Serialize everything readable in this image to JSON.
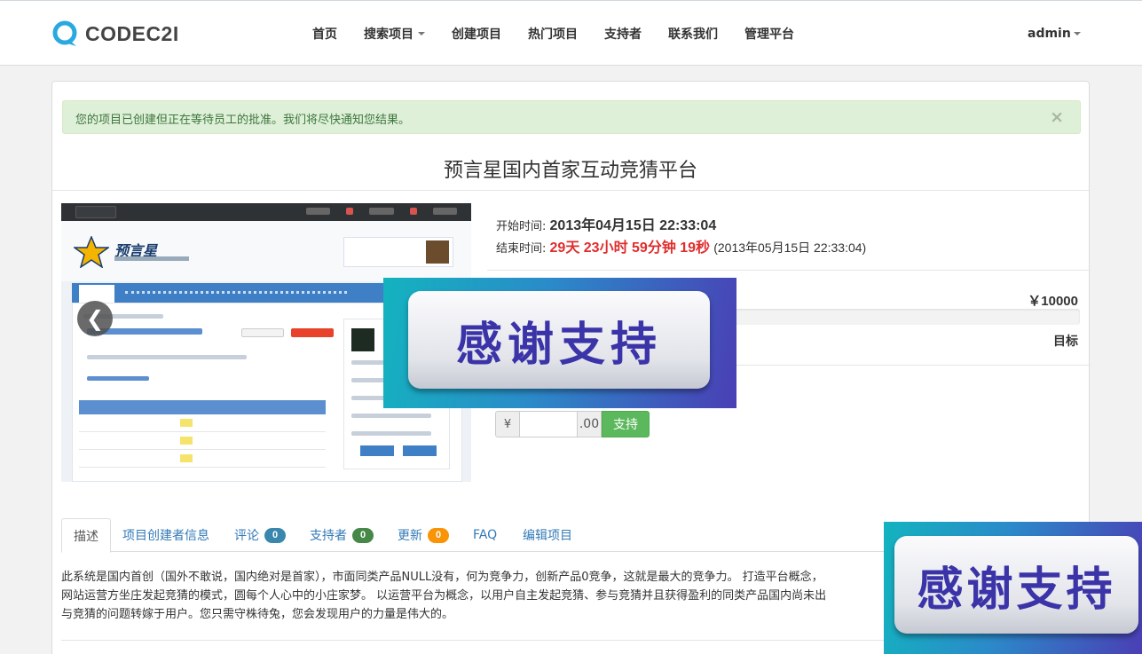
{
  "brand": {
    "name": "CODEC2I"
  },
  "nav": {
    "items": [
      "首页",
      "搜索项目",
      "创建项目",
      "热门项目",
      "支持者",
      "联系我们",
      "管理平台"
    ],
    "user": "admin"
  },
  "alert": {
    "message": "您的项目已创建但正在等待员工的批准。我们将尽快通知您结果。",
    "close": "×"
  },
  "project": {
    "title": "预言星国内首家互动竞猜平台",
    "start_label": "开始时间:",
    "start_value": "2013年04月15日 22:33:04",
    "end_label": "结束时间:",
    "countdown": "29天 23小时 59分钟 19秒",
    "end_value": "(2013年05月15日 22:33:04)",
    "goal_amount": "￥10000",
    "goal_label": "目标",
    "progress": 0
  },
  "carousel": {
    "prev": "❮",
    "logo_text": "预言星"
  },
  "donate": {
    "currency": "¥",
    "value": "",
    "cents": ".00",
    "button": "支持"
  },
  "tabs": [
    {
      "label": "描述"
    },
    {
      "label": "项目创建者信息"
    },
    {
      "label": "评论",
      "badge": "0",
      "badge_color": "#3a87ad"
    },
    {
      "label": "支持者",
      "badge": "0",
      "badge_color": "#468847"
    },
    {
      "label": "更新",
      "badge": "0",
      "badge_color": "#f89406"
    },
    {
      "label": "FAQ"
    },
    {
      "label": "编辑项目"
    }
  ],
  "description": {
    "line1": "此系统是国内首创（国外不敢说，国内绝对是首家），市面同类产品NULL没有，何为竞争力，创新产品0竞争，这就是最大的竞争力。 打造平台概念，",
    "line2": "网站运营方坐庄发起竞猜的模式，圆每个人心中的小庄家梦。 以运营平台为概念，以用户自主发起竞猜、参与竞猜并且获得盈利的同类产品国内尚未出",
    "line3": "与竞猜的问题转嫁于用户。您只需守株待兔，您会发现用户的力量是伟大的。"
  },
  "stickers": {
    "text": "感谢支持"
  },
  "colors": {
    "alert_bg": "#dff0d8",
    "countdown": "#e02d2d",
    "link": "#337ab7",
    "success": "#5cb85c"
  }
}
